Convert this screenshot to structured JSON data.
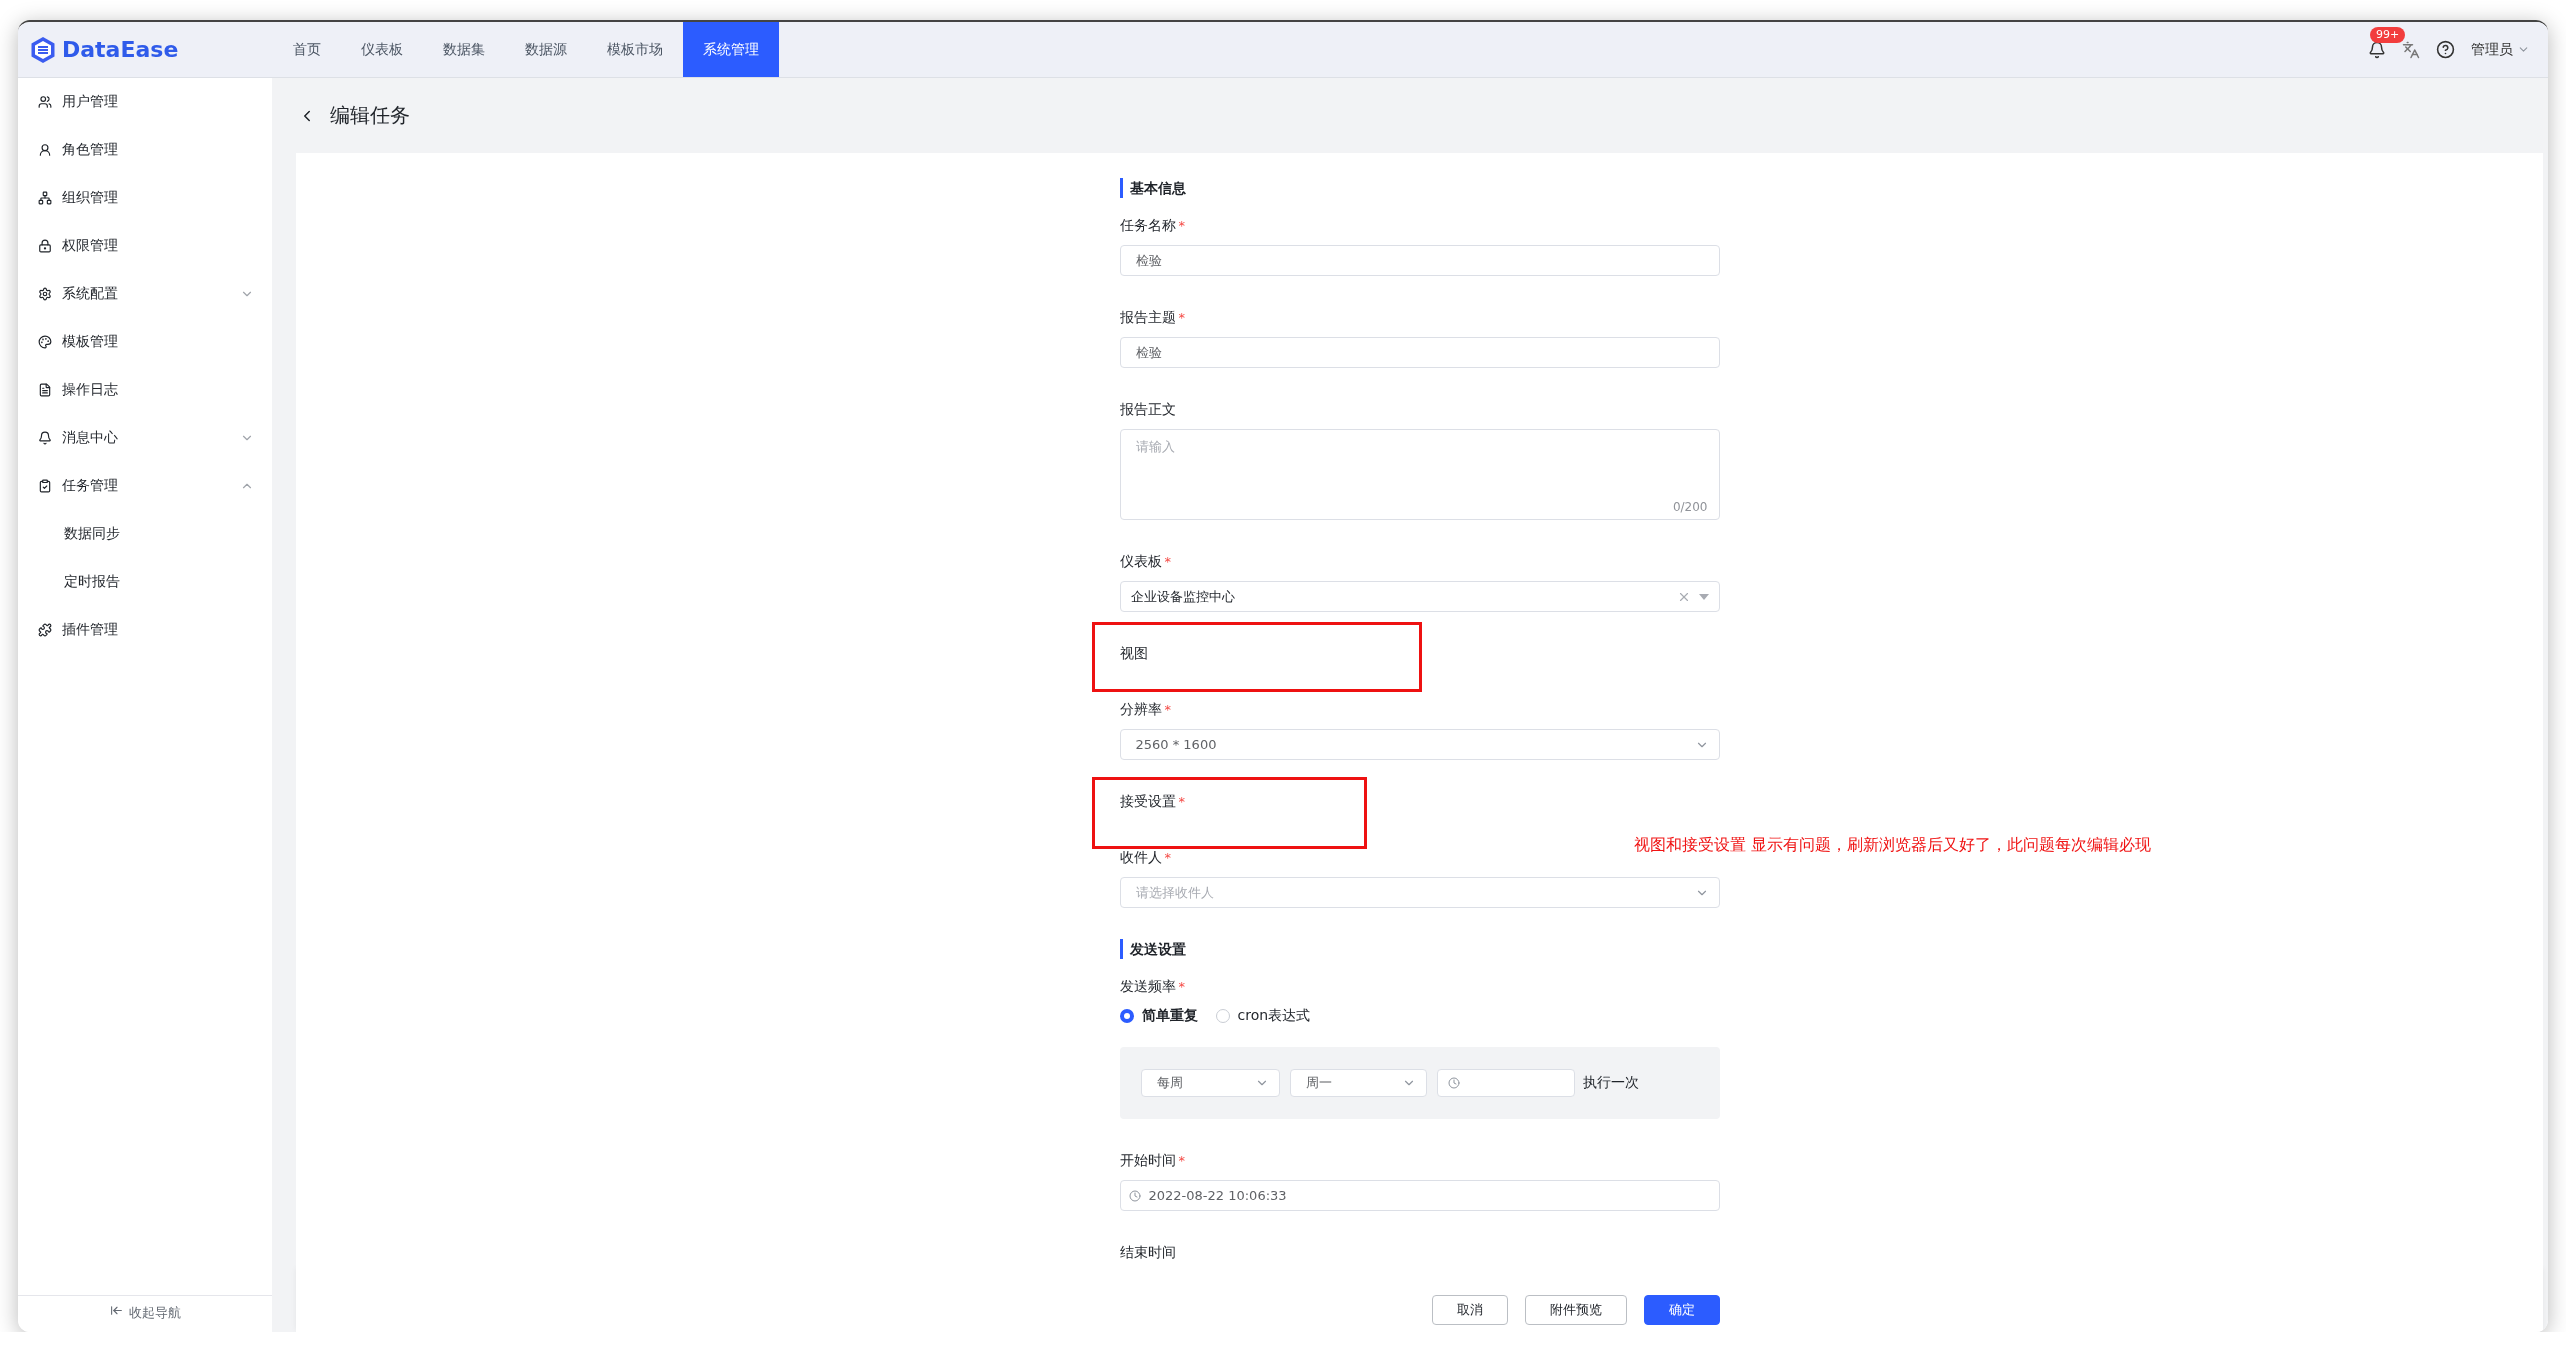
{
  "app": {
    "logo": "DataEase"
  },
  "nav": [
    {
      "label": "首页",
      "selected": false
    },
    {
      "label": "仪表板",
      "selected": false
    },
    {
      "label": "数据集",
      "selected": false
    },
    {
      "label": "数据源",
      "selected": false
    },
    {
      "label": "模板市场",
      "selected": false
    },
    {
      "label": "系统管理",
      "selected": true
    }
  ],
  "header_right": {
    "badge": "99+",
    "user": "管理员"
  },
  "sidebar": {
    "items": [
      {
        "label": "用户管理",
        "kind": "link"
      },
      {
        "label": "角色管理",
        "kind": "link"
      },
      {
        "label": "组织管理",
        "kind": "link"
      },
      {
        "label": "权限管理",
        "kind": "link"
      },
      {
        "label": "系统配置",
        "kind": "group",
        "expanded": false
      },
      {
        "label": "模板管理",
        "kind": "link"
      },
      {
        "label": "操作日志",
        "kind": "link"
      },
      {
        "label": "消息中心",
        "kind": "group",
        "expanded": false
      },
      {
        "label": "任务管理",
        "kind": "group",
        "expanded": true,
        "children": [
          {
            "label": "数据同步"
          },
          {
            "label": "定时报告"
          }
        ]
      },
      {
        "label": "插件管理",
        "kind": "link"
      }
    ],
    "collapse": "收起导航"
  },
  "page": {
    "title": "编辑任务"
  },
  "form": [
    {
      "kind": "section",
      "label": "基本信息"
    },
    {
      "kind": "input",
      "label": "任务名称",
      "mark": "*",
      "value": "检验"
    },
    {
      "kind": "input",
      "label": "报告主题",
      "mark": "*",
      "value": "检验"
    },
    {
      "kind": "textarea",
      "label": "报告正文",
      "placeholder": "请输入",
      "counter": "0/200"
    },
    {
      "kind": "select",
      "label": "仪表板",
      "mark": "*",
      "value": "企业设备监控中心",
      "clearable": true
    },
    {
      "kind": "label",
      "label": "视图",
      "highlighted": true
    },
    {
      "kind": "select",
      "label": "分辨率",
      "mark": "*",
      "value": "2560 * 1600",
      "clearable": false
    },
    {
      "kind": "label",
      "label": "接受设置",
      "mark": "*",
      "highlighted": true
    },
    {
      "kind": "select",
      "label": "收件人",
      "mark": "*",
      "placeholder": "请选择收件人",
      "clearable": false
    },
    {
      "kind": "section",
      "label": "发送设置"
    },
    {
      "kind": "radio",
      "label": "发送频率",
      "mark": "*",
      "options": [
        {
          "label": "简单重复",
          "selected": true
        },
        {
          "label": "cron表达式",
          "selected": false
        }
      ],
      "schedule": {
        "period": "每周",
        "day": "周一",
        "suffix": "执行一次"
      }
    },
    {
      "kind": "date",
      "label": "开始时间",
      "mark": "*",
      "value": "2022-08-22 10:06:33"
    },
    {
      "kind": "label",
      "label": "结束时间",
      "highlighted": false
    }
  ],
  "annotation": "视图和接受设置 显示有问题，刷新浏览器后又好了，此问题每次编辑必现",
  "buttons": [
    {
      "label": "取消",
      "kind": "default"
    },
    {
      "label": "附件预览",
      "kind": "default"
    },
    {
      "label": "确定",
      "kind": "primary"
    }
  ]
}
